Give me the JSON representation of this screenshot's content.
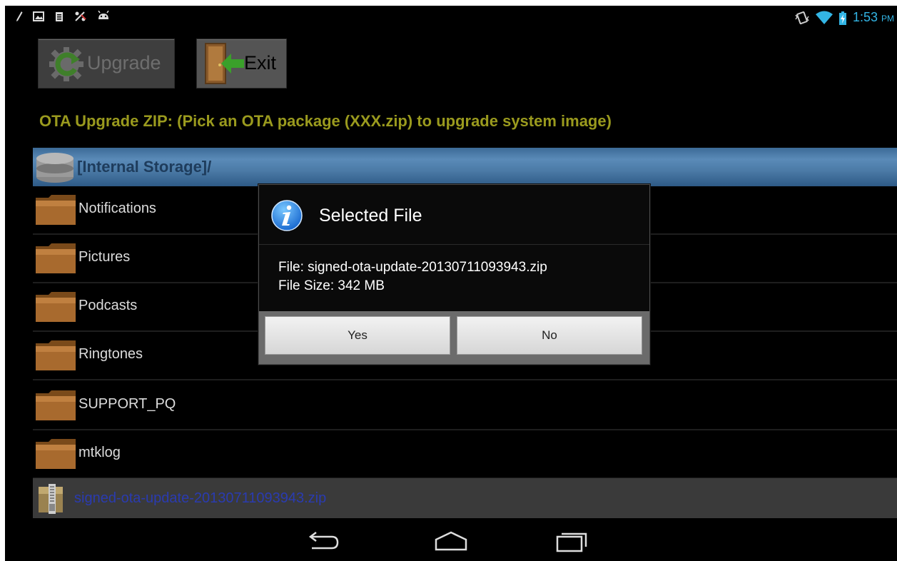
{
  "status_bar": {
    "time": "1:53",
    "ampm": "PM",
    "left_icons": [
      "pencil-icon",
      "image-icon",
      "clipboard-icon",
      "usb-debug-icon",
      "android-icon"
    ],
    "right_icons": [
      "vibrate-icon",
      "wifi-icon",
      "battery-charging-icon"
    ]
  },
  "toolbar": {
    "upgrade_label": "Upgrade",
    "exit_label": "Exit"
  },
  "ota": {
    "title": "OTA Upgrade ZIP: (Pick an OTA package (XXX.zip) to upgrade system image)"
  },
  "path": {
    "label": "[Internal Storage]/"
  },
  "files": [
    {
      "name": "Notifications",
      "type": "folder"
    },
    {
      "name": "Pictures",
      "type": "folder"
    },
    {
      "name": "Podcasts",
      "type": "folder"
    },
    {
      "name": "Ringtones",
      "type": "folder"
    },
    {
      "name": "SUPPORT_PQ",
      "type": "folder"
    },
    {
      "name": "mtklog",
      "type": "folder"
    },
    {
      "name": "signed-ota-update-20130711093943.zip",
      "type": "zip"
    }
  ],
  "dialog": {
    "title": "Selected File",
    "line1": "File: signed-ota-update-20130711093943.zip",
    "line2": "File Size: 342 MB",
    "yes_label": "Yes",
    "no_label": "No"
  },
  "colors": {
    "accent": "#33b5e5",
    "title_text": "#9a9a1e",
    "zip_text": "#2a3bb0"
  }
}
